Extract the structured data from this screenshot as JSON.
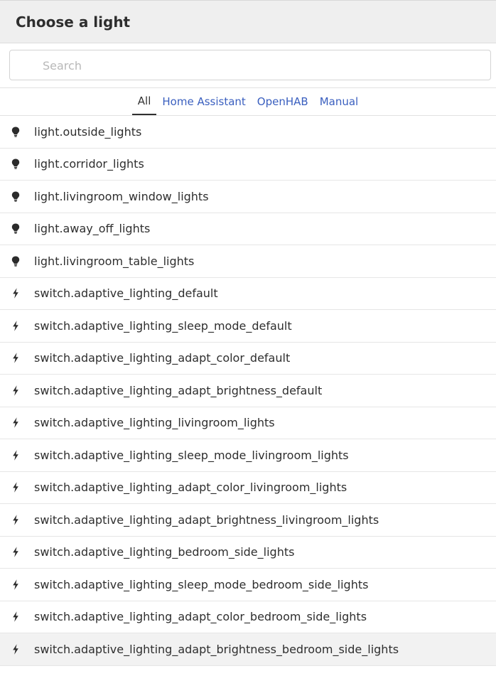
{
  "dialog": {
    "title": "Choose a light"
  },
  "search": {
    "placeholder": "Search",
    "value": ""
  },
  "tabs": [
    {
      "label": "All",
      "active": true
    },
    {
      "label": "Home Assistant",
      "active": false
    },
    {
      "label": "OpenHAB",
      "active": false
    },
    {
      "label": "Manual",
      "active": false
    }
  ],
  "items": [
    {
      "label": "light.outside_lights",
      "icon": "bulb-icon"
    },
    {
      "label": "light.corridor_lights",
      "icon": "bulb-icon"
    },
    {
      "label": "light.livingroom_window_lights",
      "icon": "bulb-icon"
    },
    {
      "label": "light.away_off_lights",
      "icon": "bulb-icon"
    },
    {
      "label": "light.livingroom_table_lights",
      "icon": "bulb-icon"
    },
    {
      "label": "switch.adaptive_lighting_default",
      "icon": "bolt-icon"
    },
    {
      "label": "switch.adaptive_lighting_sleep_mode_default",
      "icon": "bolt-icon"
    },
    {
      "label": "switch.adaptive_lighting_adapt_color_default",
      "icon": "bolt-icon"
    },
    {
      "label": "switch.adaptive_lighting_adapt_brightness_default",
      "icon": "bolt-icon"
    },
    {
      "label": "switch.adaptive_lighting_livingroom_lights",
      "icon": "bolt-icon"
    },
    {
      "label": "switch.adaptive_lighting_sleep_mode_livingroom_lights",
      "icon": "bolt-icon"
    },
    {
      "label": "switch.adaptive_lighting_adapt_color_livingroom_lights",
      "icon": "bolt-icon"
    },
    {
      "label": "switch.adaptive_lighting_adapt_brightness_livingroom_lights",
      "icon": "bolt-icon"
    },
    {
      "label": "switch.adaptive_lighting_bedroom_side_lights",
      "icon": "bolt-icon"
    },
    {
      "label": "switch.adaptive_lighting_sleep_mode_bedroom_side_lights",
      "icon": "bolt-icon"
    },
    {
      "label": "switch.adaptive_lighting_adapt_color_bedroom_side_lights",
      "icon": "bolt-icon"
    },
    {
      "label": "switch.adaptive_lighting_adapt_brightness_bedroom_side_lights",
      "icon": "bolt-icon",
      "hovered": true
    }
  ],
  "colors": {
    "accent": "#3a5fbf",
    "header_bg": "#efefef",
    "hover_bg": "#f2f2f2"
  }
}
